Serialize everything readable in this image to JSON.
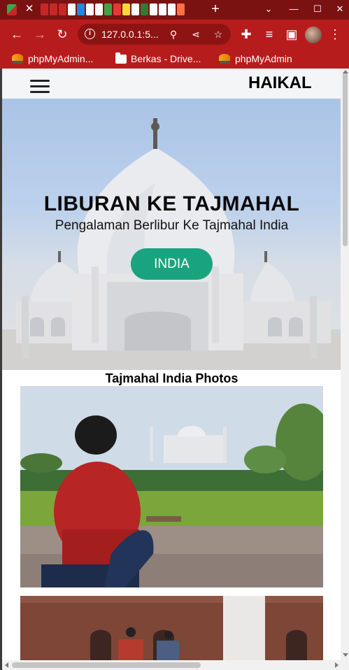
{
  "browser": {
    "tabs": [
      {
        "label": ""
      }
    ],
    "omnibox": {
      "url": "127.0.0.1:5..."
    },
    "bookmarks": [
      {
        "label": "phpMyAdmin...",
        "icon": "phpmyadmin-icon"
      },
      {
        "label": "Berkas - Drive...",
        "icon": "folder-icon"
      },
      {
        "label": "phpMyAdmin",
        "icon": "phpmyadmin-icon"
      }
    ],
    "theme_color": "#b71c1c"
  },
  "site": {
    "brand": "HAIKAL",
    "hero": {
      "title": "LIBURAN KE TAJMAHAL",
      "subtitle": "Pengalaman Berlibur Ke Tajmahal India",
      "button": "INDIA",
      "button_color": "#1aa37f"
    },
    "gallery": {
      "title": "Tajmahal India Photos",
      "photos": [
        {
          "description": "person in red hoodie sitting in front of Taj Mahal"
        },
        {
          "description": "two people in red sandstone arcade"
        }
      ]
    }
  }
}
